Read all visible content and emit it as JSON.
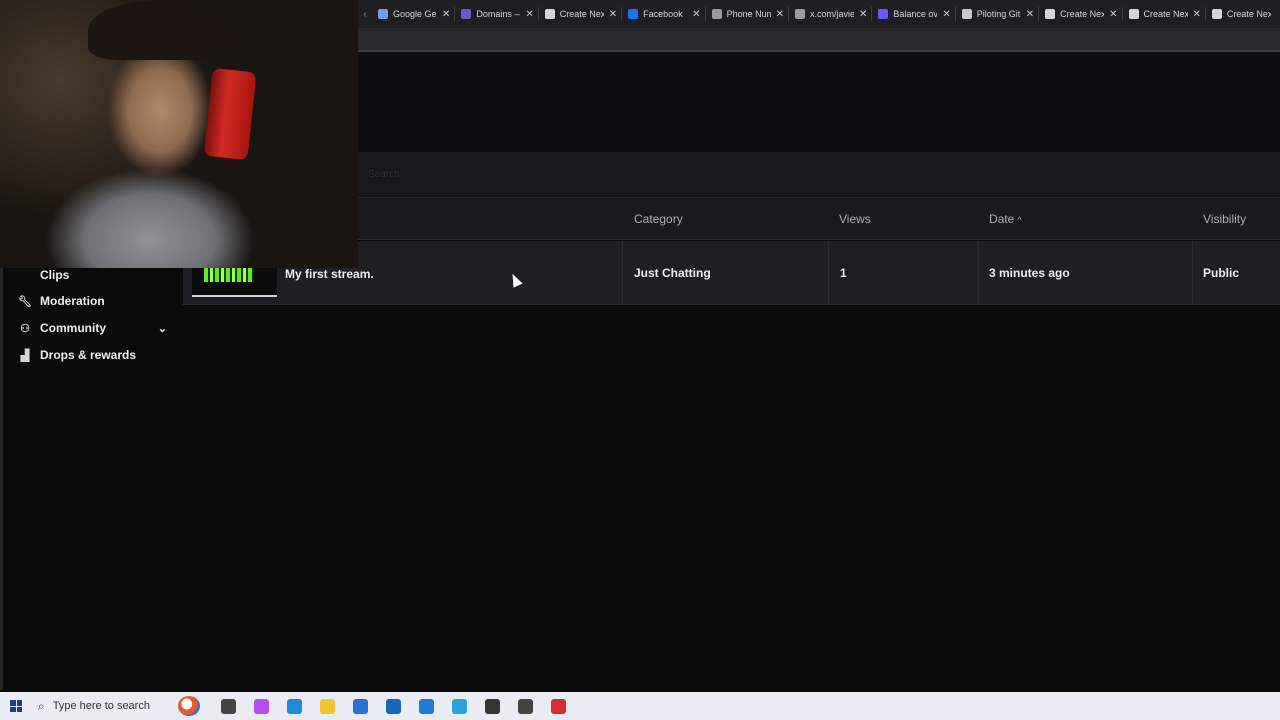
{
  "browser": {
    "tabs": [
      {
        "title": "Google Gem",
        "icon": "gemini-icon",
        "color": "#6f9df5"
      },
      {
        "title": "Domains — ",
        "icon": "domains-icon",
        "color": "#6a5acd"
      },
      {
        "title": "Create Next",
        "icon": "vercel-icon",
        "color": "#d6d6d9"
      },
      {
        "title": "Facebook",
        "icon": "facebook-icon",
        "color": "#1877f2"
      },
      {
        "title": "Phone Numb",
        "icon": "phone-icon",
        "color": "#9a9aa0"
      },
      {
        "title": "x.com/javier",
        "icon": "globe-icon",
        "color": "#9a9aa0"
      },
      {
        "title": "Balance over",
        "icon": "stripe-icon",
        "color": "#635bff"
      },
      {
        "title": "Piloting GitH",
        "icon": "github-icon",
        "color": "#c9c9cc"
      },
      {
        "title": "Create Next",
        "icon": "vercel-icon",
        "color": "#d6d6d9"
      },
      {
        "title": "Create Next",
        "icon": "vercel-icon",
        "color": "#d6d6d9"
      },
      {
        "title": "Create Nex",
        "icon": "vercel-icon",
        "color": "#d6d6d9"
      }
    ],
    "scroll_glyph": "‹",
    "close_glyph": "✕"
  },
  "filter": {
    "placeholder": "Search"
  },
  "table": {
    "headers": {
      "category": "Category",
      "views": "Views",
      "date": "Date",
      "visibility": "Visibility"
    },
    "sort_glyph": "^",
    "rows": [
      {
        "title": "My first stream.",
        "category": "Just Chatting",
        "views": "1",
        "date": "3 minutes ago",
        "visibility": "Public"
      }
    ]
  },
  "sidebar": {
    "items": [
      {
        "label": "Clips",
        "icon": "clips-icon"
      },
      {
        "label": "Moderation",
        "icon": "wrench-icon"
      },
      {
        "label": "Community",
        "icon": "community-icon",
        "expandable": true
      },
      {
        "label": "Drops & rewards",
        "icon": "drops-icon"
      }
    ]
  },
  "taskbar": {
    "search_placeholder": "Type here to search",
    "apps": [
      {
        "name": "task-view-icon",
        "color": "#444"
      },
      {
        "name": "copilot-icon",
        "color": "#b44cf0"
      },
      {
        "name": "edge-icon",
        "color": "#1f8ad6"
      },
      {
        "name": "file-explorer-icon",
        "color": "#f2c230"
      },
      {
        "name": "store-icon",
        "color": "#2a6fd6"
      },
      {
        "name": "outlook-icon",
        "color": "#1565c0"
      },
      {
        "name": "vscode-icon",
        "color": "#1f7ad6"
      },
      {
        "name": "telegram-icon",
        "color": "#2aa3dd"
      },
      {
        "name": "chatgpt-icon",
        "color": "#333333"
      },
      {
        "name": "settings-icon",
        "color": "#444444"
      },
      {
        "name": "recorder-icon",
        "color": "#d32f2f"
      }
    ]
  }
}
